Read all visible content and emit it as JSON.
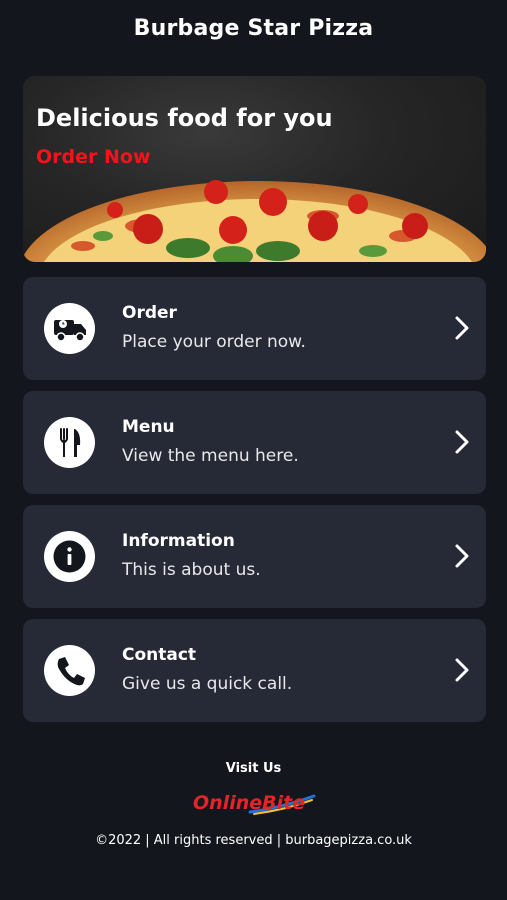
{
  "header": {
    "title": "Burbage Star Pizza"
  },
  "hero": {
    "headline": "Delicious food for you",
    "cta_label": "Order Now",
    "cta_color": "#f2141a"
  },
  "cards": [
    {
      "title": "Order",
      "subtitle": "Place your order now.",
      "icon": "delivery-truck-icon"
    },
    {
      "title": "Menu",
      "subtitle": "View the menu here.",
      "icon": "fork-knife-icon"
    },
    {
      "title": "Information",
      "subtitle": "This is about us.",
      "icon": "info-icon"
    },
    {
      "title": "Contact",
      "subtitle": "Give us a quick call.",
      "icon": "phone-icon"
    }
  ],
  "footer": {
    "visit_label": "Visit Us",
    "logo_text": "OnlineBite",
    "copyright": "©2022 | All rights reserved | burbagepizza.co.uk"
  },
  "colors": {
    "background": "#14161d",
    "card": "#262a36",
    "accent": "#f2141a"
  }
}
